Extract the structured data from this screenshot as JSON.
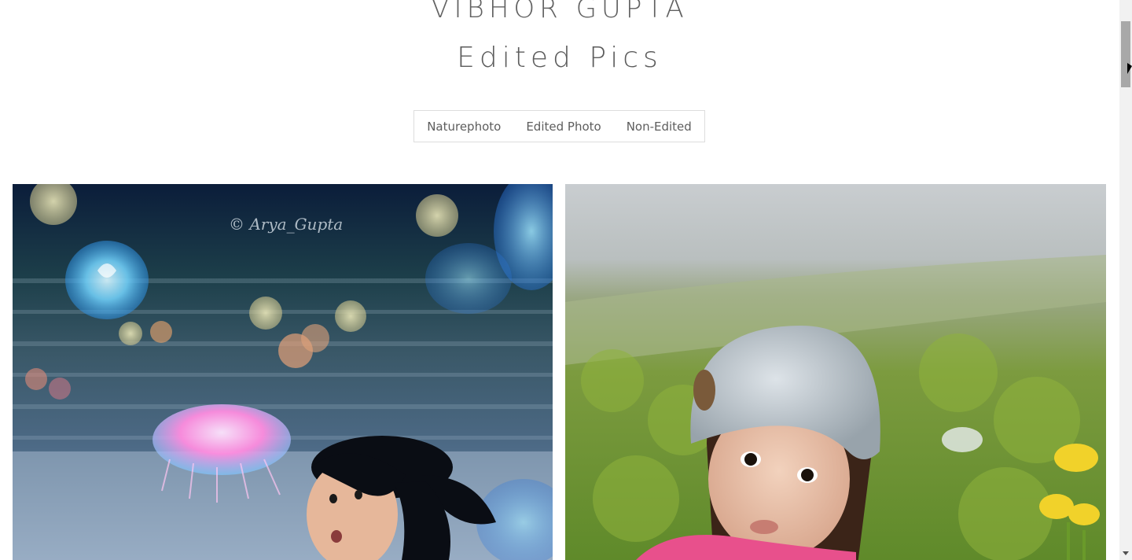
{
  "header": {
    "site_name": "VIBHOR GUPTA",
    "page_title": "Edited Pics"
  },
  "filters": [
    {
      "label": "Naturephoto"
    },
    {
      "label": "Edited Photo"
    },
    {
      "label": "Non-Edited"
    }
  ],
  "gallery": {
    "photos": [
      {
        "subject": "girl-with-jellyfish",
        "watermark": "© Arya_Gupta"
      },
      {
        "subject": "girl-in-grey-hat-on-grass"
      }
    ]
  },
  "scrollbar": {
    "up_icon": "arrow-up-icon",
    "down_icon": "arrow-down-icon"
  }
}
